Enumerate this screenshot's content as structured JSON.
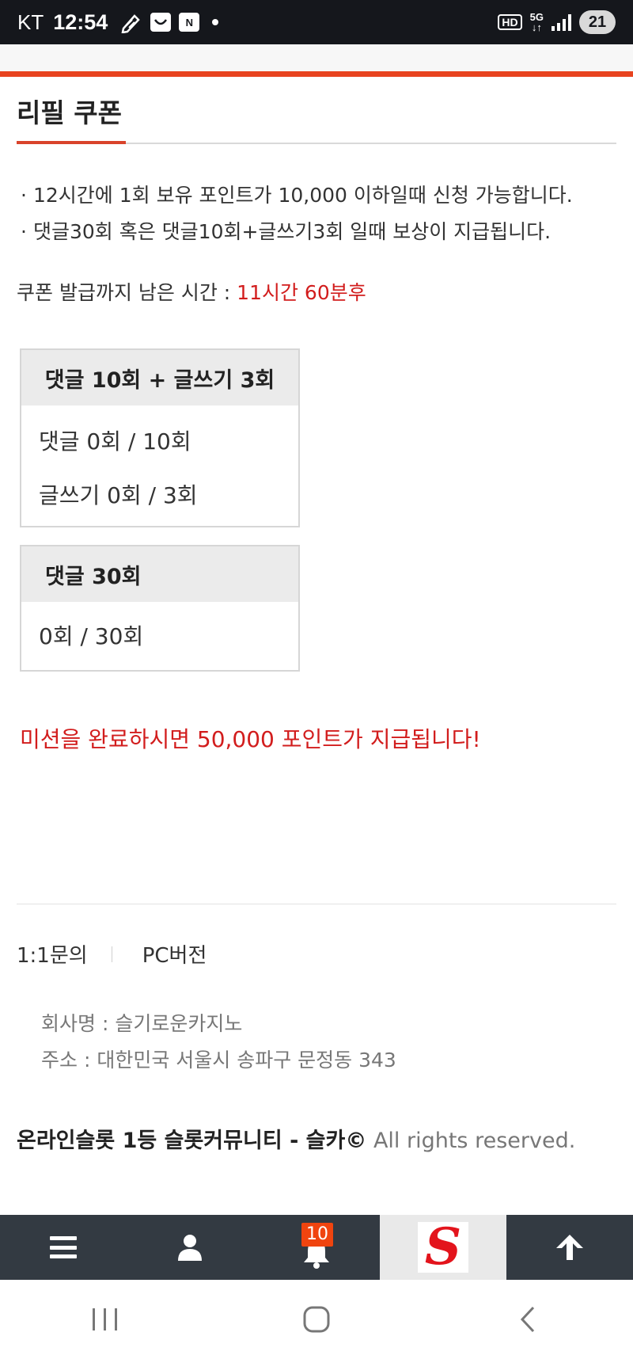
{
  "status_bar": {
    "carrier": "KT",
    "time": "12:54",
    "hd": "HD",
    "network": "5G",
    "battery": "21"
  },
  "page": {
    "title": "리필 쿠폰",
    "info_items": [
      "12시간에 1회 보유 포인트가 10,000 이하일때 신청 가능합니다.",
      "댓글30회 혹은 댓글10회+글쓰기3회 일때 보상이 지급됩니다."
    ],
    "timer_label": "쿠폰 발급까지 남은 시간 : ",
    "timer_value": "11시간 60분후",
    "missions": [
      {
        "header": "댓글 10회 + 글쓰기 3회",
        "rows": [
          "댓글 0회 / 10회",
          "글쓰기 0회 / 3회"
        ]
      },
      {
        "header": "댓글 30회",
        "rows": [
          "0회 / 30회"
        ]
      }
    ],
    "reward_text": "미션을 완료하시면 50,000 포인트가 지급됩니다!"
  },
  "footer": {
    "links": [
      "1:1문의",
      "PC버전"
    ],
    "company_name": "회사명 : 슬기로운카지노",
    "address": "주소 : 대한민국 서울시 송파구 문정동 343",
    "copyright_brand": "온라인슬롯 1등 슬롯커뮤니티 - 슬카©",
    "copyright_rights": " All rights reserved."
  },
  "bottom_nav": {
    "notification_count": "10",
    "logo_letter": "S"
  },
  "colors": {
    "accent": "#e8431f",
    "highlight_red": "#d21d1d",
    "nav_bg": "#333a42"
  }
}
